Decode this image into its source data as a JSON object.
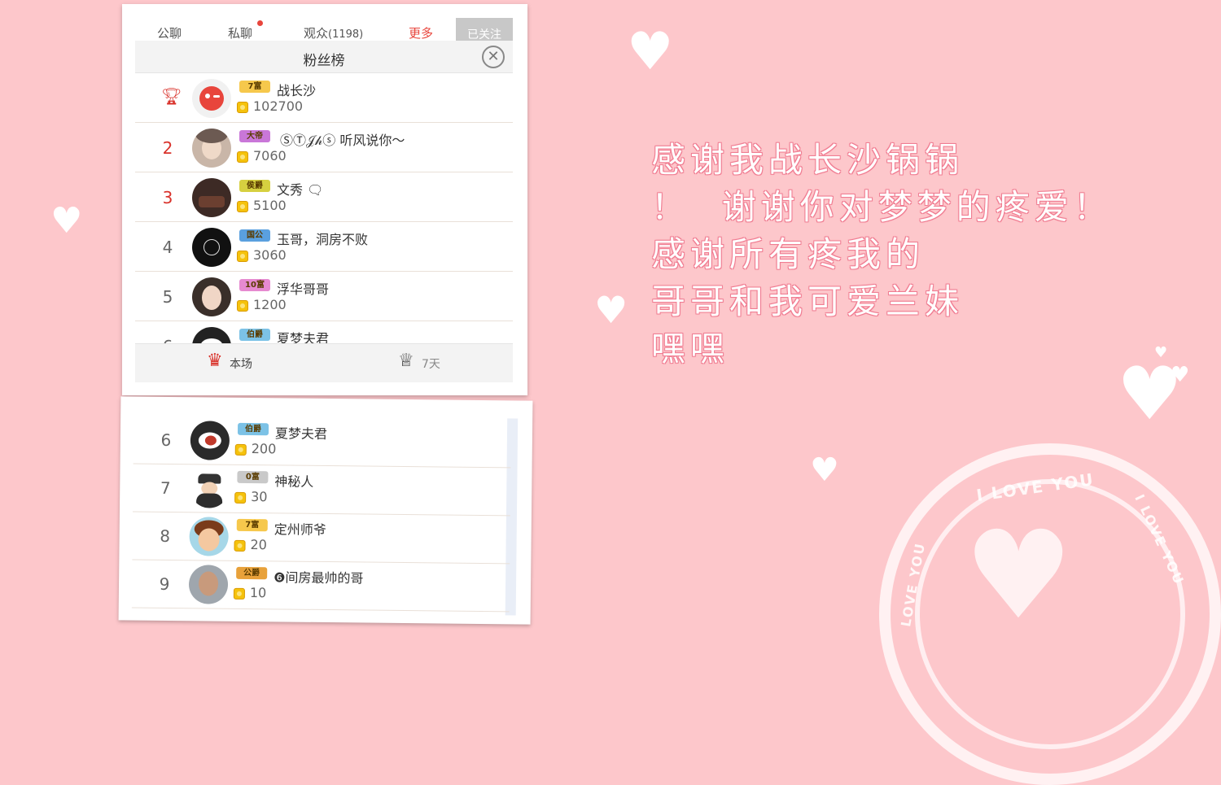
{
  "tabs": {
    "public_chat": "公聊",
    "private_chat": "私聊",
    "audience": "观众",
    "audience_count": "(1198)",
    "more": "更多",
    "followed": "已关注"
  },
  "dialog": {
    "title": "粉丝榜",
    "close_icon": "close-circle-icon"
  },
  "fans": [
    {
      "rank": "1",
      "badge": "7富",
      "badge_color": "#f6c84c",
      "name": "战长沙",
      "amount": "102700"
    },
    {
      "rank": "2",
      "badge": "大帝",
      "badge_color": "#c977d8",
      "name": "ⓈⓉ𝒥𝒽ⓢ 听风说你～",
      "amount": "7060"
    },
    {
      "rank": "3",
      "badge": "侯爵",
      "badge_color": "#d6d040",
      "name": "文秀",
      "amount": "5100"
    },
    {
      "rank": "4",
      "badge": "国公",
      "badge_color": "#5aa0df",
      "name": "玉哥，洞房不败",
      "amount": "3060"
    },
    {
      "rank": "5",
      "badge": "10富",
      "badge_color": "#e68ad0",
      "name": "浮华哥哥",
      "amount": "1200"
    },
    {
      "rank": "6",
      "badge": "伯爵",
      "badge_color": "#7cc2e6",
      "name": "夏梦夫君",
      "amount": "200"
    },
    {
      "rank": "7",
      "badge": "0富",
      "badge_color": "#c9c9c9",
      "name": "神秘人",
      "amount": "30"
    },
    {
      "rank": "8",
      "badge": "7富",
      "badge_color": "#f6c84c",
      "name": "定州师爷",
      "amount": "20"
    },
    {
      "rank": "9",
      "badge": "公爵",
      "badge_color": "#e8a13a",
      "name": "❻间房最帅的哥",
      "amount": "10"
    }
  ],
  "footer": {
    "this_show": "本场",
    "seven_days": "7天"
  },
  "message": {
    "line1": "感谢我战长沙锅锅",
    "line2": "！  谢谢你对梦梦的疼爱！",
    "line3": "感谢所有疼我的",
    "line4": "哥哥和我可爱兰妹",
    "line5": "嘿嘿"
  },
  "stamp": {
    "top_text": "I LOVE YOU",
    "side_text_right": "I LOVE YOU",
    "side_text_left": "LOVE YOU"
  },
  "colors": {
    "background": "#fdc7cb",
    "accent_red": "#d9322b",
    "message_outline": "#f07d92"
  }
}
